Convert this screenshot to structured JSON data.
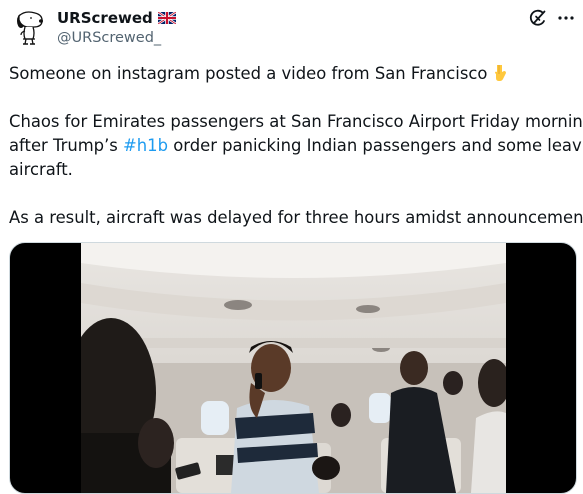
{
  "author": {
    "display_name": "URScrewed",
    "flag_icon": "uk-flag-icon",
    "handle": "@URScrewed_"
  },
  "actions": {
    "grok_icon": "grok-icon",
    "more_icon": "more-icon"
  },
  "tweet": {
    "line1": "Someone on instagram posted a video from San Francisco",
    "line1_emoji": "pointing-down-emoji",
    "line2": "Chaos for Emirates passengers at San Francisco Airport Friday morning",
    "line3_before": "after Trump’s ",
    "hashtag": "#h1b",
    "line3_after": " order panicking Indian passengers and some leaving",
    "line4": "aircraft.",
    "line5": "As a result, aircraft was delayed for three hours amidst announcement"
  },
  "media": {
    "type": "video",
    "scene": "aircraft-cabin-passengers"
  },
  "colors": {
    "link": "#1d9bf0",
    "secondary_text": "#536471",
    "border": "#cfd9de"
  }
}
